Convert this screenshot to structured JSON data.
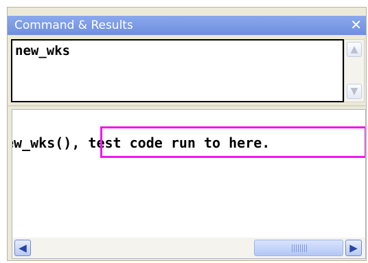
{
  "window": {
    "title": "Command & Results",
    "close_glyph": "✕"
  },
  "command": {
    "text": "new_wks"
  },
  "results": {
    "line": "ew_wks(), test code run to here."
  },
  "scrollbars": {
    "vertical_up_glyph": "▲",
    "vertical_down_glyph": "▼",
    "horizontal_left_glyph": "◀",
    "horizontal_right_glyph": "▶"
  },
  "colors": {
    "titlebar": "#7a97e6",
    "highlight": "#ee18ee"
  }
}
